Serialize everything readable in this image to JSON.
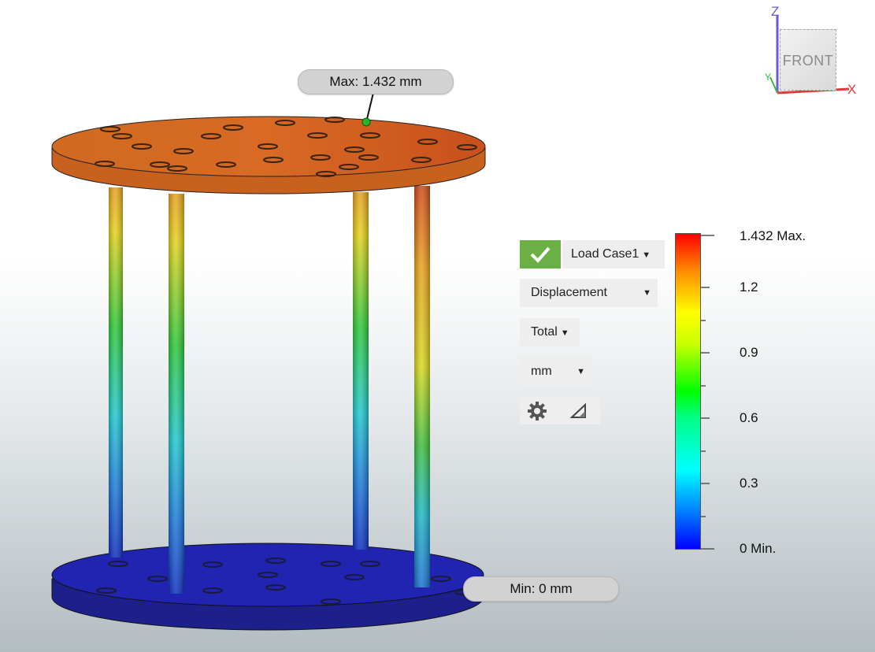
{
  "callouts": {
    "max": "Max: 1.432 mm",
    "min": "Min: 0 mm"
  },
  "viewcube": {
    "face": "FRONT",
    "axis_z": "Z",
    "axis_x": "X",
    "axis_y": "Y"
  },
  "controls": {
    "load_case": "Load Case1",
    "result_type": "Displacement",
    "component": "Total",
    "units": "mm",
    "settings_icon": "gear-icon",
    "deformation_icon": "deformation-scale-icon"
  },
  "legend": {
    "labels": [
      "1.432 Max.",
      "1.2",
      "0.9",
      "0.6",
      "0.3",
      "0 Min."
    ],
    "colors": [
      "#ff0000",
      "#ffff00",
      "#00ff00",
      "#00ffff",
      "#0000ff"
    ]
  }
}
